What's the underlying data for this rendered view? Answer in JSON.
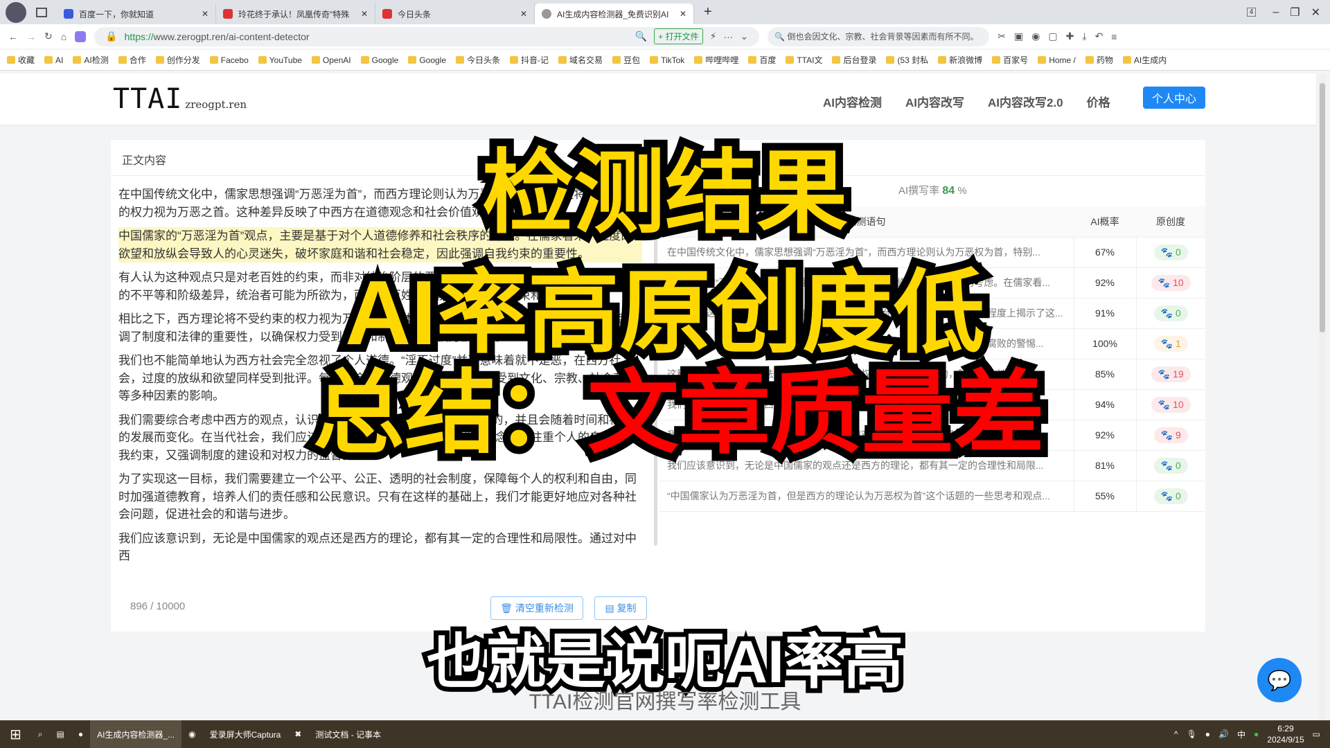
{
  "browser": {
    "tabs": [
      {
        "label": "百度一下，你就知道"
      },
      {
        "label": "玲花终于承认！凤凰传奇\"特殊"
      },
      {
        "label": "今日头条"
      },
      {
        "label": "AI生成内容检测器_免费识别AI"
      }
    ],
    "url_scheme": "https://",
    "url_rest": "www.zerogpt.ren/ai-content-detector",
    "open_file": "+ 打开文件",
    "search_text": "倒也会因文化、宗教、社会背景等因素而有所不同。",
    "tab_count": "4",
    "bookmarks": [
      "收藏",
      "AI",
      "AI检测",
      "合作",
      "创作分发",
      "Facebo",
      "YouTube",
      "OpenAI",
      "Google",
      "Google",
      "今日头条",
      "抖音-记",
      "域名交易",
      "豆包",
      "TikTok",
      "哔哩哔哩",
      "百度",
      "TTAI文",
      "后台登录",
      "(53 封私",
      "新浪微博",
      "百家号",
      "Home /",
      "药物",
      "AI生成内"
    ]
  },
  "site": {
    "logo": "TTAI",
    "logo_domain": "zreogpt.ren",
    "nav": [
      "AI内容检测",
      "AI内容改写",
      "AI内容改写2.0",
      "价格"
    ],
    "user_center": "个人中心"
  },
  "editor": {
    "title": "正文内容",
    "paragraphs": [
      "在中国传统文化中，儒家思想强调“万恶淫为首”，而西方理论则认为万恶权为首，特别是将不受约束的权力视为万恶之首。这种差异反映了中西方在道德观念和社会价值观上的不同。",
      "中国儒家的“万恶淫为首”观点，主要是基于对个人道德修养和社会秩序的考虑。在儒家看来，过度的欲望和放纵会导致人的心灵迷失，破坏家庭和谐和社会稳定，因此强调自我约束的重要性。",
      "有人认为这种观点只是对老百姓的约束，而非对统治阶层的要求。这在一定程度上揭示了社会中存在的不平等和阶级差异，统治者可能为所欲为，而普通百姓则可能受到更多的约束和限制。",
      "相比之下，西方理论将不受约束的权力视为万恶之首，体现了对权力滥用和腐败的警惕。这种观点强调了制度和法律的重要性，以确保权力受到监督和制约，防止权力被滥用。",
      "我们也不能简单地认为西方社会完全忽视了个人道德。“淫不过度”并不意味着就不是恶，在西方社会，过度的放纵和欲望同样受到批评。每个社会的道德观念和行为准则都受到文化、宗教、社会背景等多种因素的影响。",
      "我们需要综合考虑中西方的观点，认识到道德观念和对“恶”的理解是相对的，并且会随着时间和社会的发展而变化。在当代社会，我们应该追求一种更加平衡和全面的道德观念，既注重个人的自律和自我约束，又强调制度的建设和对权力的监督。",
      "为了实现这一目标，我们需要建立一个公平、公正、透明的社会制度，保障每个人的权利和自由，同时加强道德教育，培养人们的责任感和公民意识。只有在这样的基础上，我们才能更好地应对各种社会问题，促进社会的和谐与进步。",
      "我们应该意识到，无论是中国儒家的观点还是西方的理论，都有其一定的合理性和局限性。通过对中西"
    ],
    "highlighted_index": 1,
    "char_count": "896 / 10000",
    "clear_button": "清空重新检测",
    "copy_button": "复制"
  },
  "result": {
    "rate_label": "AI撰写率",
    "rate_value": "84",
    "rate_unit": " %",
    "columns": [
      "检测语句",
      "AI概率",
      "原创度"
    ],
    "rows": [
      {
        "s": "在中国传统文化中，儒家思想强调“万恶淫为首”，而西方理论则认为万恶权为首，特别...",
        "p": "67%",
        "o": "0",
        "c": "g"
      },
      {
        "s": "中国儒家的“万恶淫为首”观点，主要是基于对个人道德修养和社会秩序的考虑。在儒家看...",
        "p": "92%",
        "o": "10",
        "c": "r"
      },
      {
        "s": "有人认为这种观点只是对老百姓的约束，而非对统治阶层的要求。这在一定程度上揭示了这...",
        "p": "91%",
        "o": "0",
        "c": "g"
      },
      {
        "s": "相比之下，西方理论将不受约束的权力视为万恶之首，体现了对权力滥用和腐败的警惕...",
        "p": "100%",
        "o": "1",
        "c": "y"
      },
      {
        "s": "这种观点强调了制度和法律的重要性，以确保权力受到监督和制约，防止权力被滥用...",
        "p": "85%",
        "o": "19",
        "c": "r"
      },
      {
        "s": "我们也不能简单地认为西方社会完全忽视了个人道德。“淫不过度”并不意味着就不是恶...",
        "p": "94%",
        "o": "10",
        "c": "r"
      },
      {
        "s": "我们需要综合考虑中西方的观点，认识到道德观念和对“恶”的理解是相对的...",
        "p": "92%",
        "o": "9",
        "c": "r"
      },
      {
        "s": "我们应该意识到，无论是中国儒家的观点还是西方的理论，都有其一定的合理性和局限...",
        "p": "81%",
        "o": "0",
        "c": "g"
      },
      {
        "s": "“中国儒家认为万恶淫为首，但是西方的理论认为万恶权为首”这个话题的一些思考和观点...",
        "p": "55%",
        "o": "0",
        "c": "g"
      }
    ]
  },
  "overlay": {
    "line1": "检测结果",
    "line2": "AI率高原创度低",
    "line3a": "总结：",
    "line3b": "文章质量差",
    "subtitle": "也就是说呃AI率高",
    "caption": "TTAI检测官网撰写率检测工具"
  },
  "taskbar": {
    "items": [
      "AI生成内容检测器_...",
      "爱录屏大师Captura",
      "测试文档 - 记事本"
    ],
    "ime": "中",
    "time": "6:29",
    "date": "2024/9/15"
  },
  "colors": {
    "accent": "#1e88f5",
    "overlay_yellow": "#ffd800",
    "overlay_red": "#ff0000",
    "good": "#4caf50",
    "bad": "#e05263"
  }
}
